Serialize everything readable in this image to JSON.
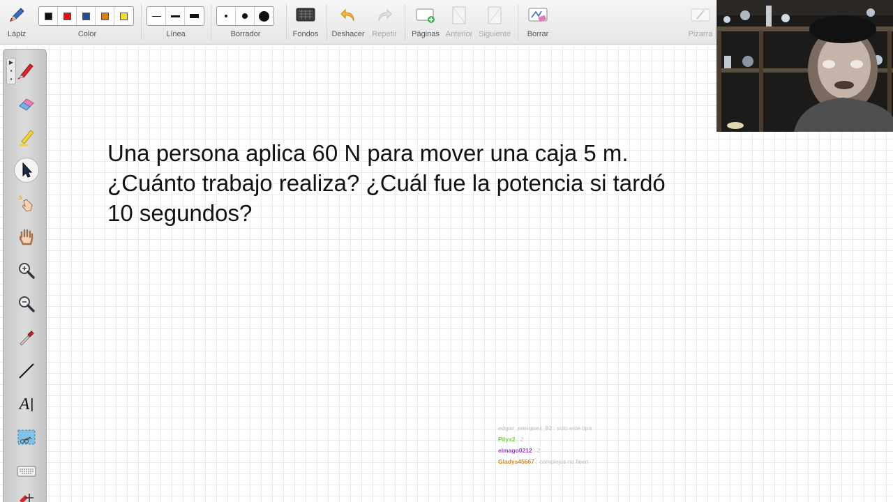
{
  "toolbar": {
    "pencil_label": "Lápiz",
    "color_label": "Color",
    "line_label": "Línea",
    "eraser_label": "Borrador",
    "backgrounds_label": "Fondos",
    "undo_label": "Deshacer",
    "redo_label": "Repetir",
    "pages_label": "Páginas",
    "prev_label": "Anterior",
    "next_label": "Siguiente",
    "clear_label": "Borrar",
    "board_label": "Pizarra",
    "colors": [
      "#111111",
      "#e01010",
      "#1f4e9a",
      "#d9820f",
      "#f2e21b"
    ]
  },
  "problem": {
    "line1": "Una persona aplica 60 N para mover una caja 5 m.",
    "line2": "¿Cuánto trabajo realiza? ¿Cuál fue la potencia si tardó",
    "line3": "10 segundos?"
  },
  "chat": [
    {
      "user": "edgar_enriquez_92",
      "sep": " : ",
      "text": "solo este tipo",
      "color": "#c8c8c8"
    },
    {
      "user": "Pilyx2",
      "sep": " : ",
      "text": "2",
      "color": "#7bd23a"
    },
    {
      "user": "elmago0212",
      "sep": " : ",
      "text": "2",
      "color": "#9b3fd1"
    },
    {
      "user": "Gladys45667",
      "sep": " : ",
      "text": "complejos no lleen",
      "color": "#d98a1c"
    }
  ],
  "palette_tools": [
    {
      "name": "pen-tool",
      "icon": "pen-icon"
    },
    {
      "name": "eraser-tool",
      "icon": "eraser-icon"
    },
    {
      "name": "highlighter-tool",
      "icon": "highlighter-icon"
    },
    {
      "name": "select-tool",
      "icon": "arrow-cursor-icon"
    },
    {
      "name": "pointer-tool",
      "icon": "pointing-hand-icon"
    },
    {
      "name": "pan-tool",
      "icon": "hand-icon"
    },
    {
      "name": "zoom-in-tool",
      "icon": "zoom-in-icon"
    },
    {
      "name": "zoom-out-tool",
      "icon": "zoom-out-icon"
    },
    {
      "name": "eyedropper-tool",
      "icon": "eyedropper-icon"
    },
    {
      "name": "line-tool",
      "icon": "line-icon"
    },
    {
      "name": "text-tool",
      "icon": "text-icon"
    },
    {
      "name": "capture-tool",
      "icon": "screen-capture-icon"
    },
    {
      "name": "keyboard-tool",
      "icon": "keyboard-icon"
    },
    {
      "name": "more-tool",
      "icon": "more-icon"
    }
  ],
  "text_tool_glyph": "A"
}
